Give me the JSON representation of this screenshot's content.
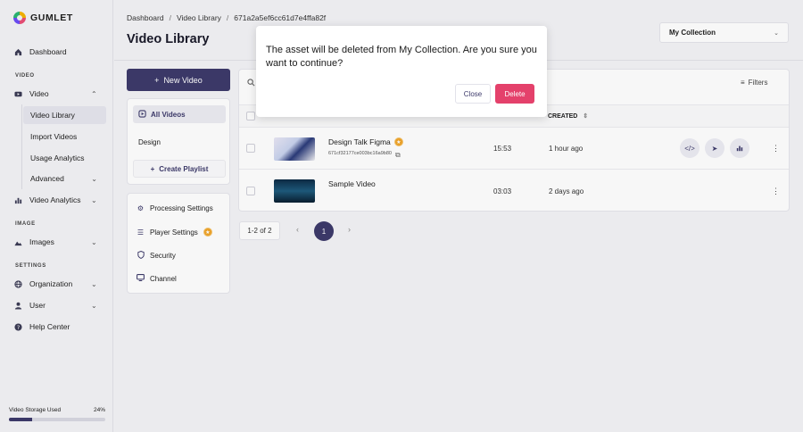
{
  "app": {
    "logo_text": "GUMLET"
  },
  "sidebar": {
    "dashboard": "Dashboard",
    "section_video": "VIDEO",
    "video": "Video",
    "video_sub": [
      "Video Library",
      "Import Videos",
      "Usage Analytics",
      "Advanced"
    ],
    "video_analytics": "Video Analytics",
    "section_image": "IMAGE",
    "images": "Images",
    "section_settings": "SETTINGS",
    "organization": "Organization",
    "user": "User",
    "help_center": "Help Center",
    "storage_label": "Video Storage Used",
    "storage_percent_text": "24%",
    "storage_fraction": 0.24
  },
  "header": {
    "breadcrumb": [
      "Dashboard",
      "Video Library",
      "671a2a5ef6cc61d7e4ffa82f"
    ],
    "title": "Video Library",
    "collection": "My Collection"
  },
  "left_panel": {
    "new_video": "New Video",
    "all_videos": "All Videos",
    "design": "Design",
    "create_playlist": "Create Playlist",
    "settings": [
      "Processing Settings",
      "Player Settings",
      "Security",
      "Channel"
    ]
  },
  "table": {
    "filters": "Filters",
    "col_created": "CREATED",
    "rows": [
      {
        "title": "Design Talk Figma",
        "id": "671cf32177ce003bc16a9b80",
        "duration": "15:53",
        "created": "1 hour ago"
      },
      {
        "title": "Sample Video",
        "id": "",
        "duration": "03:03",
        "created": "2 days ago"
      }
    ]
  },
  "pagination": {
    "count": "1-2 of 2",
    "current_page": "1"
  },
  "dialog": {
    "message": "The asset will be deleted from My Collection. Are you sure you want to continue?",
    "close": "Close",
    "delete": "Delete"
  },
  "colors": {
    "primary": "#3d3a6b",
    "danger": "#e4416b",
    "badge": "#f0a52a"
  }
}
